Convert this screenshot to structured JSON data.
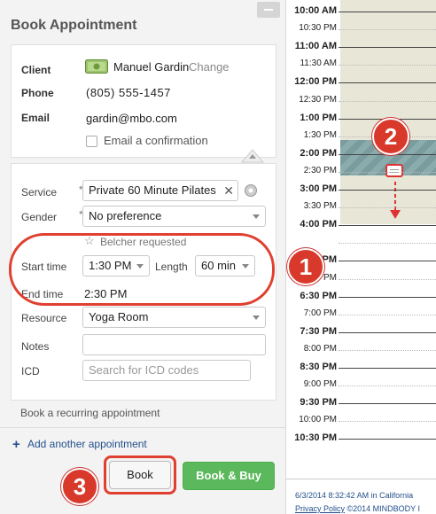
{
  "panel": {
    "title": "Book Appointment",
    "client_label": "Client",
    "client_name": "Manuel Gardin",
    "change_link": "Change",
    "phone_label": "Phone",
    "phone_value": "(805) 555-1457",
    "email_label": "Email",
    "email_value": "gardin@mbo.com",
    "email_confirm_label": "Email a confirmation",
    "email_confirm_checked": false
  },
  "form": {
    "service_label": "Service",
    "service_value": "Private 60 Minute Pilates",
    "gender_label": "Gender",
    "gender_value": "No preference",
    "requested_label": "Belcher requested",
    "start_time_label": "Start time",
    "start_time_value": "1:30 PM",
    "length_label": "Length",
    "length_value": "60 min",
    "end_time_label": "End time",
    "end_time_value": "2:30 PM",
    "resource_label": "Resource",
    "resource_value": "Yoga Room",
    "notes_label": "Notes",
    "icd_label": "ICD",
    "icd_placeholder": "Search for ICD codes",
    "required_marker": "*"
  },
  "actions": {
    "recurring_link": "Book a recurring appointment",
    "add_another_icon": "+",
    "add_another_link": "Add another appointment",
    "book_label": "Book",
    "book_buy_label": "Book & Buy"
  },
  "calendar": {
    "times": [
      "10:00 AM",
      "10:30 PM",
      "11:00 AM",
      "11:30 AM",
      "12:00 PM",
      "12:30 PM",
      "1:00 PM",
      "1:30 PM",
      "2:00 PM",
      "2:30 PM",
      "3:00 PM",
      "3:30 PM",
      "4:00 PM",
      "",
      "5:30 PM",
      "6:00 PM",
      "6:30 PM",
      "7:00 PM",
      "7:30 PM",
      "8:00 PM",
      "8:30 PM",
      "9:00 PM",
      "9:30 PM",
      "10:00 PM",
      "10:30 PM"
    ],
    "footer_date": "6/3/2014 8:32:42 AM in California",
    "footer_privacy": "Privacy Policy",
    "footer_copyright": "©2014 MINDBODY I"
  },
  "callouts": [
    "1",
    "2",
    "3"
  ],
  "colors": {
    "book_buy_green": "#5cb85c",
    "callout_red": "#d8392b",
    "calendar_column": "#e8e6d6",
    "appointment_block": "#7a9c9e"
  },
  "icons": {
    "client_card": "money-card-icon",
    "clear_service": "clear-x-icon",
    "service_options": "gear-icon",
    "requested_star": "star-outline-icon",
    "collapse": "chevron-up-icon",
    "drag_handle": "drag-handle-icon",
    "drag_arrow": "down-arrow-icon"
  }
}
